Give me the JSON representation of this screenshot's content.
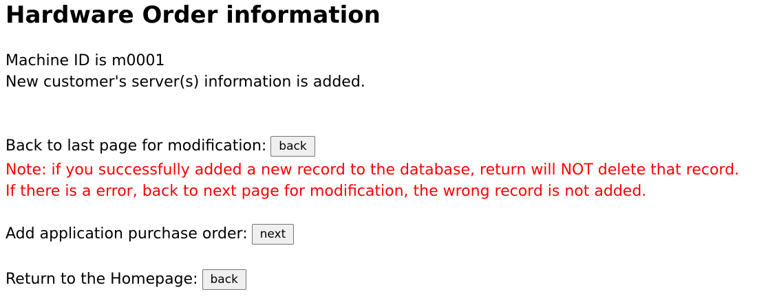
{
  "title": "Hardware Order information",
  "machine_line": "Machine ID is m0001",
  "status_line": "New customer's server(s) information is added.",
  "modify": {
    "label": "Back to last page for modification:",
    "button": "back"
  },
  "notes": {
    "line1": "Note: if you successfully added a new record to the database, return will NOT delete that record.",
    "line2": "If there is a error, back to next page for modification, the wrong record is not added."
  },
  "application_order": {
    "label": "Add application purchase order:",
    "button": "next"
  },
  "homepage": {
    "label": "Return to the Homepage:",
    "button": "back"
  },
  "colors": {
    "note_text": "#ff0000",
    "button_bg": "#efefef",
    "button_border": "#767676"
  }
}
